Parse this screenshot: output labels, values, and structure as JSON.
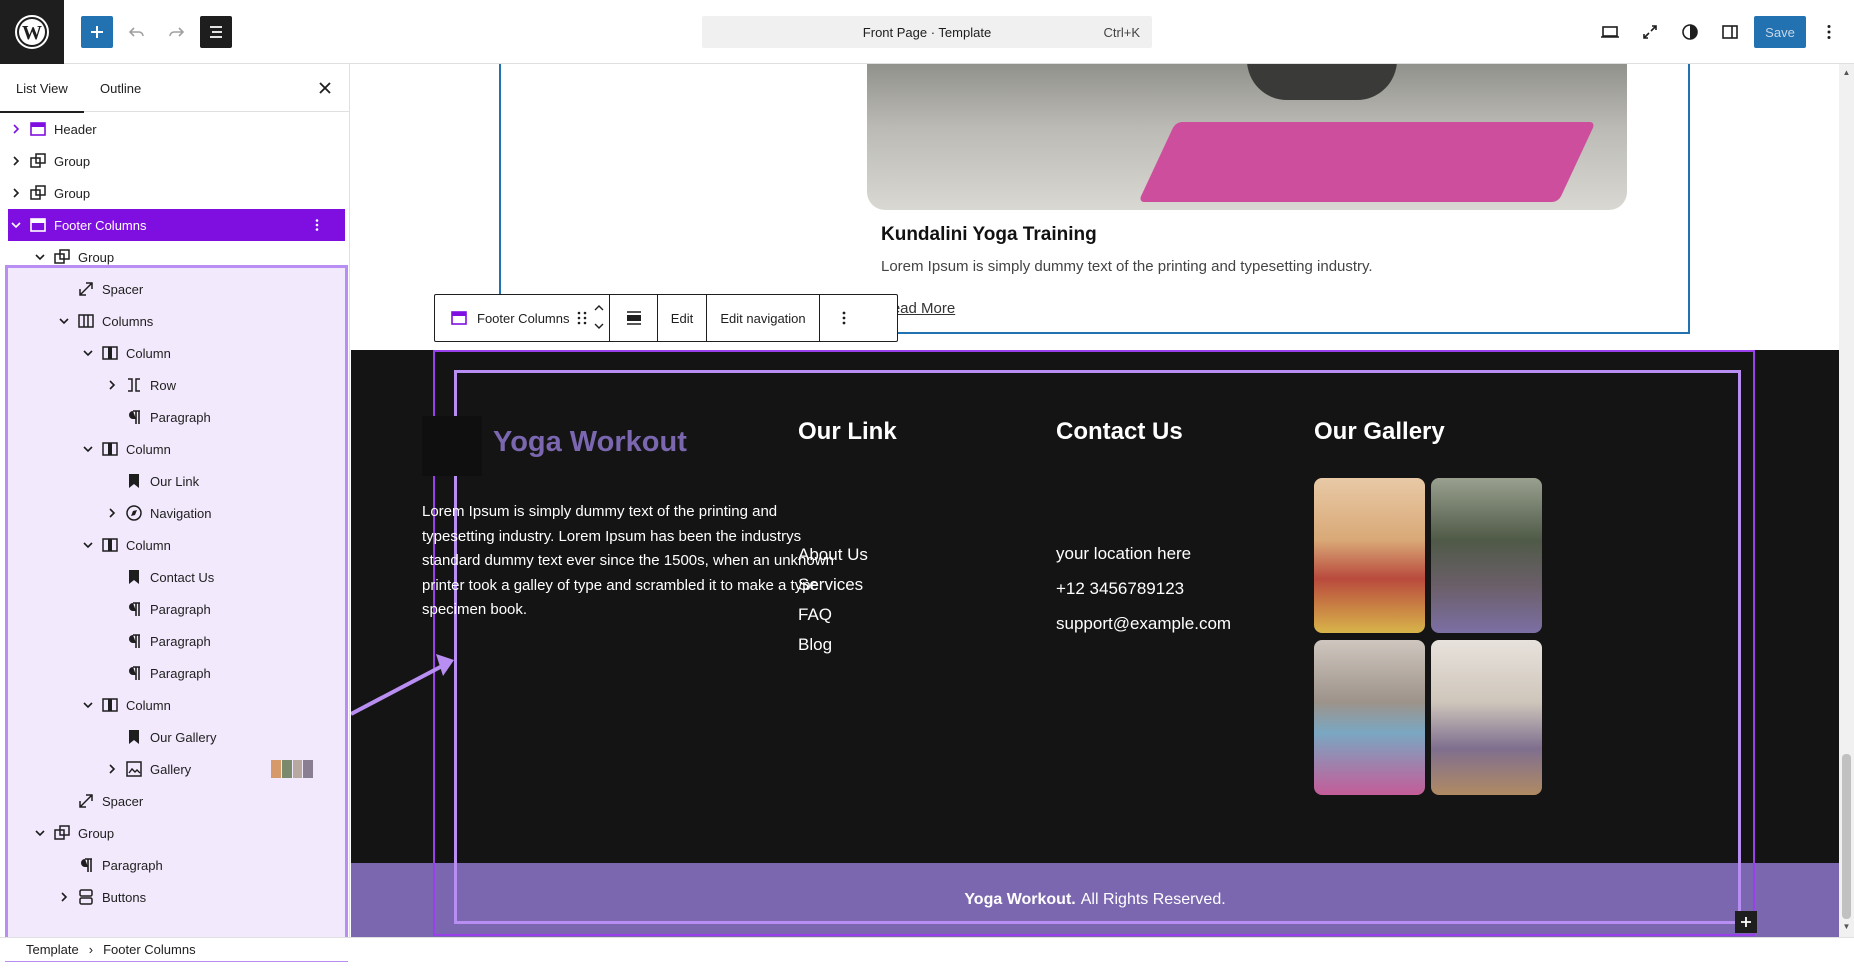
{
  "topbar": {
    "command_title": "Front Page · Template",
    "command_shortcut": "Ctrl+K",
    "save_label": "Save"
  },
  "sidebar": {
    "tabs": [
      "List View",
      "Outline"
    ],
    "items": [
      {
        "label": "Header",
        "icon": "template-part-icon",
        "depth": 0,
        "expand": "collapsed"
      },
      {
        "label": "Group",
        "icon": "group-icon",
        "depth": 0,
        "expand": "collapsed"
      },
      {
        "label": "Group",
        "icon": "group-icon",
        "depth": 0,
        "expand": "collapsed"
      },
      {
        "label": "Footer Columns",
        "icon": "template-part-icon",
        "depth": 0,
        "expand": "expanded",
        "selected": true
      },
      {
        "label": "Group",
        "icon": "group-icon",
        "depth": 1,
        "expand": "expanded"
      },
      {
        "label": "Spacer",
        "icon": "spacer-icon",
        "depth": 2,
        "expand": "none"
      },
      {
        "label": "Columns",
        "icon": "columns-icon",
        "depth": 2,
        "expand": "expanded"
      },
      {
        "label": "Column",
        "icon": "column-icon",
        "depth": 3,
        "expand": "expanded"
      },
      {
        "label": "Row",
        "icon": "row-icon",
        "depth": 4,
        "expand": "collapsed"
      },
      {
        "label": "Paragraph",
        "icon": "paragraph-icon",
        "depth": 4,
        "expand": "none"
      },
      {
        "label": "Column",
        "icon": "column-icon",
        "depth": 3,
        "expand": "expanded"
      },
      {
        "label": "Our Link",
        "icon": "heading-bookmark-icon",
        "depth": 4,
        "expand": "none"
      },
      {
        "label": "Navigation",
        "icon": "navigation-icon",
        "depth": 4,
        "expand": "collapsed"
      },
      {
        "label": "Column",
        "icon": "column-icon",
        "depth": 3,
        "expand": "expanded"
      },
      {
        "label": "Contact Us",
        "icon": "heading-bookmark-icon",
        "depth": 4,
        "expand": "none"
      },
      {
        "label": "Paragraph",
        "icon": "paragraph-icon",
        "depth": 4,
        "expand": "none"
      },
      {
        "label": "Paragraph",
        "icon": "paragraph-icon",
        "depth": 4,
        "expand": "none"
      },
      {
        "label": "Paragraph",
        "icon": "paragraph-icon",
        "depth": 4,
        "expand": "none"
      },
      {
        "label": "Column",
        "icon": "column-icon",
        "depth": 3,
        "expand": "expanded"
      },
      {
        "label": "Our Gallery",
        "icon": "heading-bookmark-icon",
        "depth": 4,
        "expand": "none"
      },
      {
        "label": "Gallery",
        "icon": "gallery-icon",
        "depth": 4,
        "expand": "collapsed"
      },
      {
        "label": "Spacer",
        "icon": "spacer-icon",
        "depth": 2,
        "expand": "none"
      },
      {
        "label": "Group",
        "icon": "group-icon",
        "depth": 1,
        "expand": "expanded"
      },
      {
        "label": "Paragraph",
        "icon": "paragraph-icon",
        "depth": 2,
        "expand": "none"
      },
      {
        "label": "Buttons",
        "icon": "buttons-icon",
        "depth": 2,
        "expand": "collapsed"
      }
    ]
  },
  "breadcrumbs": [
    "Template",
    "Footer Columns"
  ],
  "post": {
    "title": "Kundalini Yoga Training",
    "description": "Lorem Ipsum is simply dummy text of the printing and typesetting industry.",
    "read_more": "Read More"
  },
  "block_toolbar": {
    "block_name": "Footer Columns",
    "edit_label": "Edit",
    "edit_navigation_label": "Edit navigation"
  },
  "footer": {
    "brand": "Yoga Workout",
    "about": "Lorem Ipsum is simply dummy text of the printing and typesetting industry. Lorem Ipsum has been the industrys standard dummy text ever since the 1500s, when an unknown printer took a galley of type and scrambled it to make a type specimen book.",
    "links_heading": "Our Link",
    "links": [
      "About Us",
      "Services",
      "FAQ",
      "Blog"
    ],
    "contact_heading": "Contact Us",
    "contact": [
      "your location here",
      "+12 3456789123",
      "support@example.com"
    ],
    "gallery_heading": "Our Gallery",
    "copyright_brand": "Yoga Workout.",
    "copyright_text": "All Rights Reserved."
  },
  "colors": {
    "wp_dark": "#1e1e1e",
    "primary_blue": "#2271b1",
    "selection_purple": "#7e0fe0",
    "brand_purple": "#7b67b0",
    "footer_bg": "#141414"
  }
}
